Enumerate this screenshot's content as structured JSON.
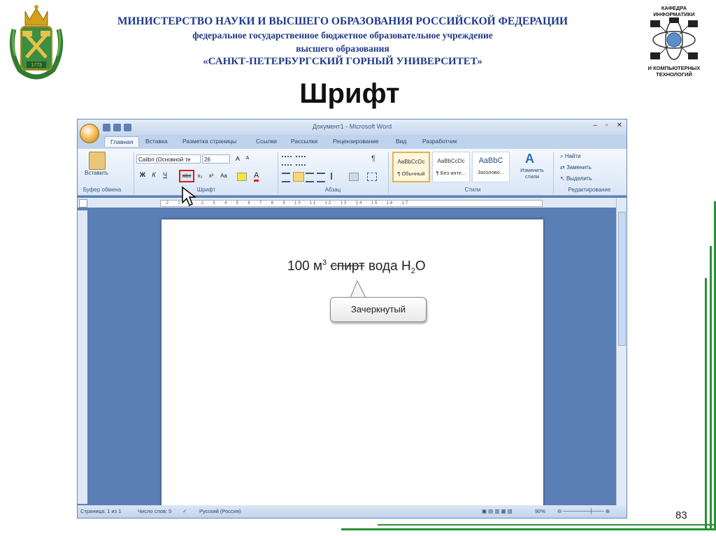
{
  "header": {
    "line1": "МИНИСТЕРСТВО НАУКИ И ВЫСШЕГО ОБРАЗОВАНИЯ РОССИЙСКОЙ ФЕДЕРАЦИИ",
    "line2": "федеральное государственное бюджетное образовательное учреждение",
    "line3": "высшего образования",
    "line4": "«САНКТ-ПЕТЕРБУРГСКИЙ ГОРНЫЙ УНИВЕРСИТЕТ»"
  },
  "logo_left": {
    "year": "1773"
  },
  "logo_right": {
    "top_text": "КАФЕДРА ИНФОРМАТИКИ",
    "bottom_text": "И КОМПЬЮТЕРНЫХ ТЕХНОЛОГИЙ"
  },
  "slide": {
    "title": "Шрифт",
    "page_number": "83"
  },
  "word": {
    "title": "Документ1 - Microsoft Word",
    "tabs": [
      "Главная",
      "Вставка",
      "Разметка страницы",
      "Ссылки",
      "Рассылки",
      "Рецензирование",
      "Вид",
      "Разработчик"
    ],
    "clipboard": {
      "paste": "Вставить",
      "label": "Буфер обмена"
    },
    "font": {
      "name": "Calibri (Основной те",
      "size": "26",
      "label": "Шрифт",
      "bold": "Ж",
      "italic": "К",
      "underline": "Ч",
      "strike": "abc",
      "sub": "x₂",
      "sup": "x²",
      "case": "Aa",
      "grow": "A",
      "shrink": "A"
    },
    "paragraph": {
      "label": "Абзац"
    },
    "styles": {
      "label": "Стили",
      "items": [
        {
          "preview": "AaBbCcDc",
          "name": "¶ Обычный"
        },
        {
          "preview": "AaBbCcDc",
          "name": "¶ Без инте..."
        },
        {
          "preview": "AaBbC",
          "name": "Заголово..."
        }
      ],
      "change": "Изменить стили"
    },
    "editing": {
      "label": "Редактирование",
      "find": "Найти",
      "replace": "Заменить",
      "select": "Выделить"
    },
    "ruler_text": "· 2 · 1 · 1 · 2 · 3 · 4 · 5 · 6 · 7 · 8 · 9 · 10 · 11 · 12 · 13 · 14 · 15 · 16 · 17",
    "document": {
      "t1": "100 м",
      "t1_sup": "3",
      "t2": "спирт",
      "t3": "вода Н",
      "t3_sub": "2",
      "t4": "О",
      "callout": "Зачеркнутый"
    },
    "status": {
      "page": "Страница: 1 из 1",
      "words": "Число слов: 5",
      "lang": "Русский (Россия)",
      "zoom": "90%"
    }
  },
  "colors": {
    "header_blue": "#1f3a8a",
    "frame_green": "#2a8f38",
    "word_bg": "#5a7fb4"
  }
}
